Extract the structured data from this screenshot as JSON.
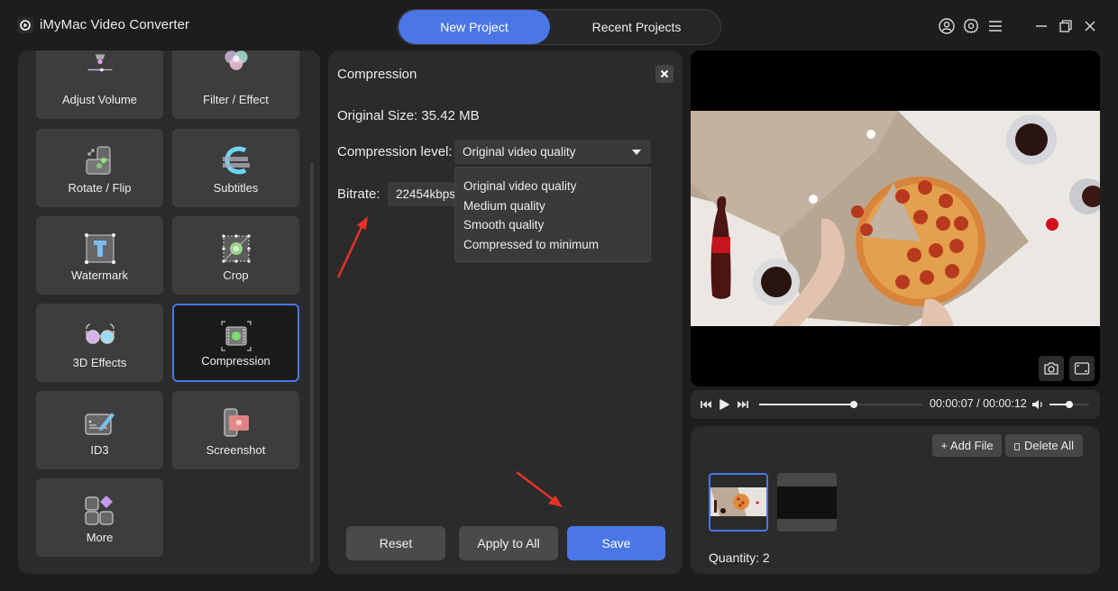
{
  "app": {
    "title": "iMyMac Video Converter",
    "tabs": [
      {
        "label": "New Project",
        "active": true
      },
      {
        "label": "Recent Projects",
        "active": false
      }
    ],
    "window_icons": [
      "account-icon",
      "settings-icon",
      "menu-icon",
      "minimize-icon",
      "restore-icon",
      "close-icon"
    ]
  },
  "tools": {
    "items": [
      {
        "label": "Adjust Volume",
        "icon": "volume-adjust-icon"
      },
      {
        "label": "Filter / Effect",
        "icon": "filter-icon"
      },
      {
        "label": "Rotate / Flip",
        "icon": "rotate-icon"
      },
      {
        "label": "Subtitles",
        "icon": "subtitles-icon"
      },
      {
        "label": "Watermark",
        "icon": "watermark-icon"
      },
      {
        "label": "Crop",
        "icon": "crop-icon"
      },
      {
        "label": "3D Effects",
        "icon": "3d-glasses-icon"
      },
      {
        "label": "Compression",
        "icon": "compression-icon",
        "selected": true
      },
      {
        "label": "ID3",
        "icon": "id3-tag-icon"
      },
      {
        "label": "Screenshot",
        "icon": "screenshot-icon"
      },
      {
        "label": "More",
        "icon": "more-apps-icon"
      }
    ]
  },
  "compression": {
    "title": "Compression",
    "original_size": "Original Size: 35.42 MB",
    "level_label": "Compression level:",
    "level_value": "Original video quality",
    "level_options": [
      "Original video quality",
      "Medium quality",
      "Smooth quality",
      "Compressed to minimum"
    ],
    "bitrate_label": "Bitrate:",
    "bitrate_value": "22454kbps",
    "buttons": {
      "reset": "Reset",
      "apply_all": "Apply to All",
      "save": "Save"
    }
  },
  "player": {
    "current_time": "00:00:07",
    "total_time": "00:00:12",
    "time_text": "00:00:07 / 00:00:12",
    "progress": 0.58,
    "volume": 0.5
  },
  "files": {
    "add_label": "+ Add File",
    "delete_label": "Delete All",
    "quantity": "Quantity: 2"
  },
  "colors": {
    "accent": "#4a76e6",
    "background": "#1d1d1d",
    "panel": "#2b2b2b",
    "tile": "#3d3d3d",
    "annotation_arrow": "#e53228"
  }
}
